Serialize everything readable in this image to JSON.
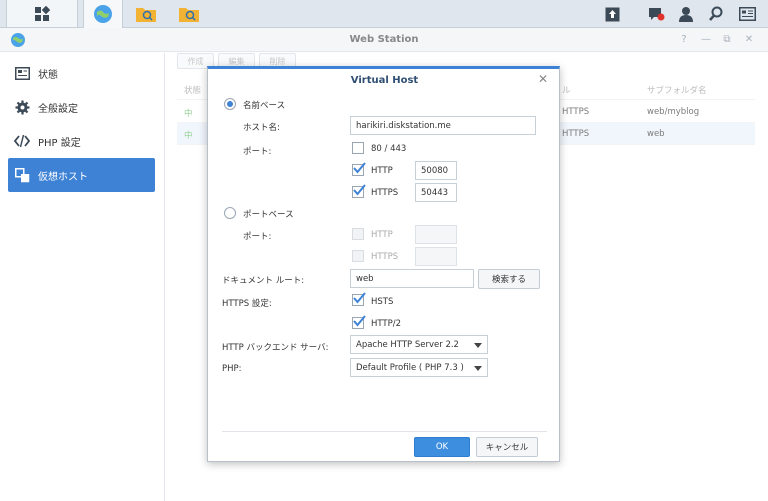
{
  "window": {
    "title": "Web Station"
  },
  "sidebar": {
    "items": [
      {
        "label": "状態",
        "icon": "status-icon"
      },
      {
        "label": "全般設定",
        "icon": "gear-icon"
      },
      {
        "label": "PHP 設定",
        "icon": "code-icon"
      },
      {
        "label": "仮想ホスト",
        "icon": "virtual-host-icon",
        "active": true
      }
    ]
  },
  "toolbar": {
    "create": "作成",
    "edit": "編集",
    "delete": "削除"
  },
  "table": {
    "headers": {
      "status": "状態",
      "protocol": "ル",
      "subfolder": "サブフォルダ名"
    },
    "rows": [
      {
        "status": "中",
        "protocol": "HTTPS",
        "subfolder": "web/myblog"
      },
      {
        "status": "中",
        "protocol": "HTTPS",
        "subfolder": "web"
      }
    ]
  },
  "dialog": {
    "title": "Virtual Host",
    "name_based": "名前ベース",
    "hostname_label": "ホスト名:",
    "hostname_value": "harikiri.diskstation.me",
    "port_label": "ポート:",
    "port_default": "80 / 443",
    "http_label": "HTTP",
    "http_port": "50080",
    "https_label": "HTTPS",
    "https_port": "50443",
    "port_based": "ポートベース",
    "port_label2": "ポート:",
    "http_label2": "HTTP",
    "https_label2": "HTTPS",
    "docroot_label": "ドキュメント ルート:",
    "docroot_value": "web",
    "browse_button": "検索する",
    "https_settings_label": "HTTPS 設定:",
    "hsts_label": "HSTS",
    "http2_label": "HTTP/2",
    "backend_label": "HTTP バックエンド サーバ:",
    "backend_value": "Apache HTTP Server 2.2",
    "php_label": "PHP:",
    "php_value": "Default Profile ( PHP 7.3 )",
    "ok_button": "OK",
    "cancel_button": "キャンセル"
  },
  "colors": {
    "accent": "#3e82d6",
    "status_green": "#5cb85c"
  }
}
